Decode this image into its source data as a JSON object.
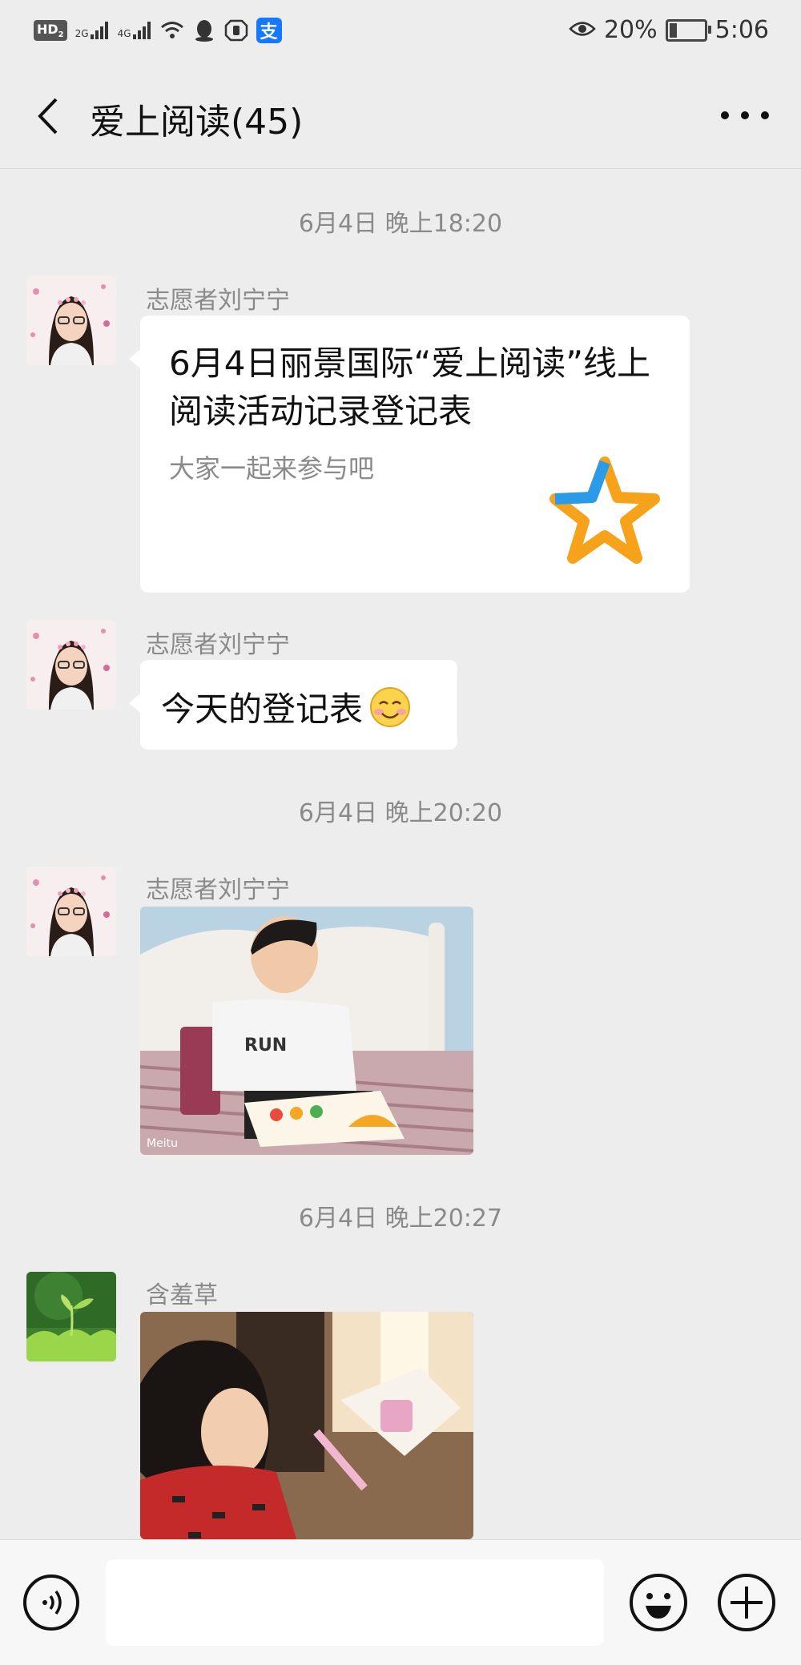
{
  "status_bar": {
    "hd": "HD",
    "hd_sub": "2",
    "net1": "2G",
    "net2": "4G",
    "battery_percent": "20%",
    "battery_level": 0.2,
    "time": "5:06"
  },
  "header": {
    "title": "爱上阅读(45)"
  },
  "messages": [
    {
      "timestamp": "6月4日 晚上18:20"
    },
    {
      "sender": "志愿者刘宁宁",
      "type": "card",
      "card_title": "6月4日丽景国际“爱上阅读”线上阅读活动记录登记表",
      "card_desc": "大家一起来参与吧",
      "icon": "star-icon"
    },
    {
      "sender": "志愿者刘宁宁",
      "type": "text",
      "text": "今天的登记表",
      "emoji": "smiling-face-emoji"
    },
    {
      "timestamp": "6月4日 晚上20:20"
    },
    {
      "sender": "志愿者刘宁宁",
      "type": "image",
      "watermark": "Meitu"
    },
    {
      "timestamp": "6月4日 晚上20:27"
    },
    {
      "sender": "含羞草",
      "type": "image"
    }
  ],
  "input_bar": {
    "voice_icon": "voice-icon",
    "emoji_icon": "emoji-icon",
    "plus_icon": "plus-icon",
    "text_value": ""
  },
  "colors": {
    "background": "#ededed",
    "bubble": "#ffffff",
    "timestamp": "#8a8a8a",
    "star_orange": "#f7a21b",
    "star_blue": "#2b9be8"
  }
}
